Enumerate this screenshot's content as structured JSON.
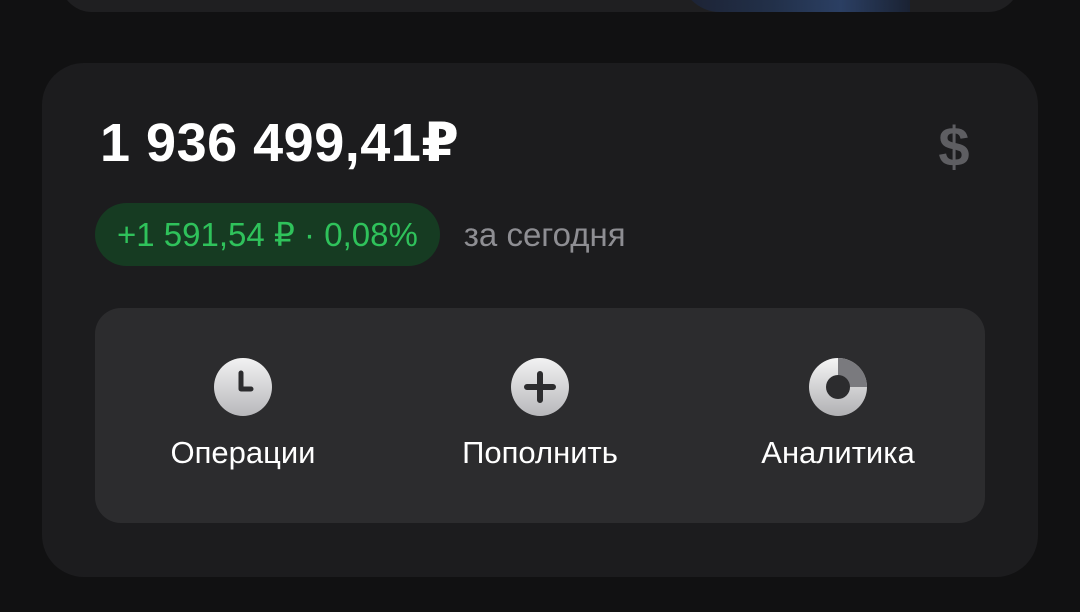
{
  "balance": {
    "amount": "1 936 499,41₽",
    "currency_icon": "dollar-icon",
    "currency_symbol": "$"
  },
  "change": {
    "value": "+1 591,54 ₽ · 0,08%",
    "period": "за сегодня",
    "color": "#2fc25b"
  },
  "actions": [
    {
      "label": "Операции",
      "icon": "clock-icon"
    },
    {
      "label": "Пополнить",
      "icon": "plus-icon"
    },
    {
      "label": "Аналитика",
      "icon": "pie-chart-icon"
    }
  ],
  "colors": {
    "background": "#111112",
    "card": "#1c1c1e",
    "panel": "#2c2c2e",
    "positive": "#2fc25b",
    "positive_bg": "#163b22",
    "muted": "#8e8e93"
  }
}
